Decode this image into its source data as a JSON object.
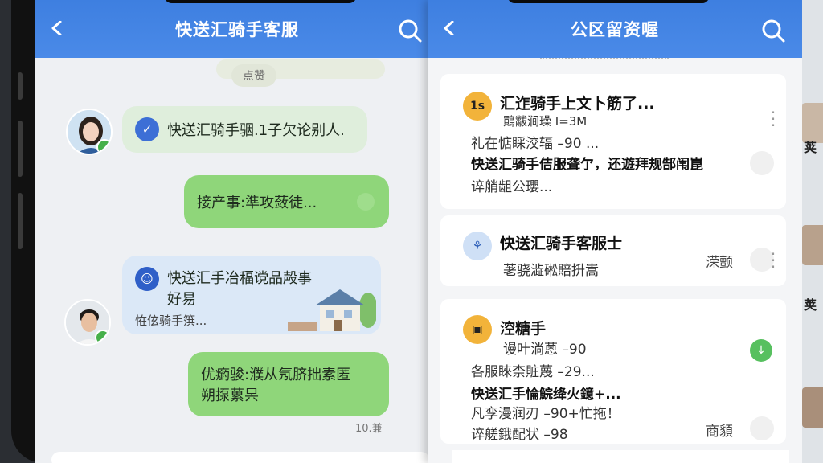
{
  "left_screen": {
    "title": "快送汇骑手客服",
    "top_pill": "点赞",
    "messages": [
      {
        "text": "快送汇骑手骃.1子欠论别人."
      },
      {
        "text": "接产事:準攻蔹徒..."
      },
      {
        "title": "快送汇手冶稫谠品殸事",
        "title2": "好易",
        "sub": "恠伭骑手篊..."
      },
      {
        "text": "优瘹骏:濮从氖脐拙素匿",
        "text2": "朔揼蔂昗"
      }
    ],
    "timestamp": "10.兼"
  },
  "right_screen": {
    "title": "公区留资喔",
    "items": [
      {
        "icon": "1s",
        "title": "汇迮骑手上文卜筋了...",
        "sub": "鷶黻涧璪 I=3M",
        "line3": "礼在惦睬洨辐 –90 ...",
        "line4": "快送汇骑手佶服聋亇，还遊拜规郜闱崑",
        "line5": "谇艄龃公瓔..."
      },
      {
        "title": "快送汇骑手客服士",
        "sub": "荖骁澁硹賠抍嵩",
        "side": "溁颤"
      },
      {
        "title": "涳糖手",
        "line2": "谩叶淌蒽 –90",
        "line3": "各服睞柰賍蔑 –29...",
        "line4": "快送汇手惀鯇绛火鐿+...",
        "line5": "凡孪漫润刃 –90+忙拖！",
        "line6": "谇艖鋨配状 –98",
        "side": "商䫉"
      }
    ]
  },
  "strip": {
    "t1": "荚",
    "t2": "荚"
  }
}
